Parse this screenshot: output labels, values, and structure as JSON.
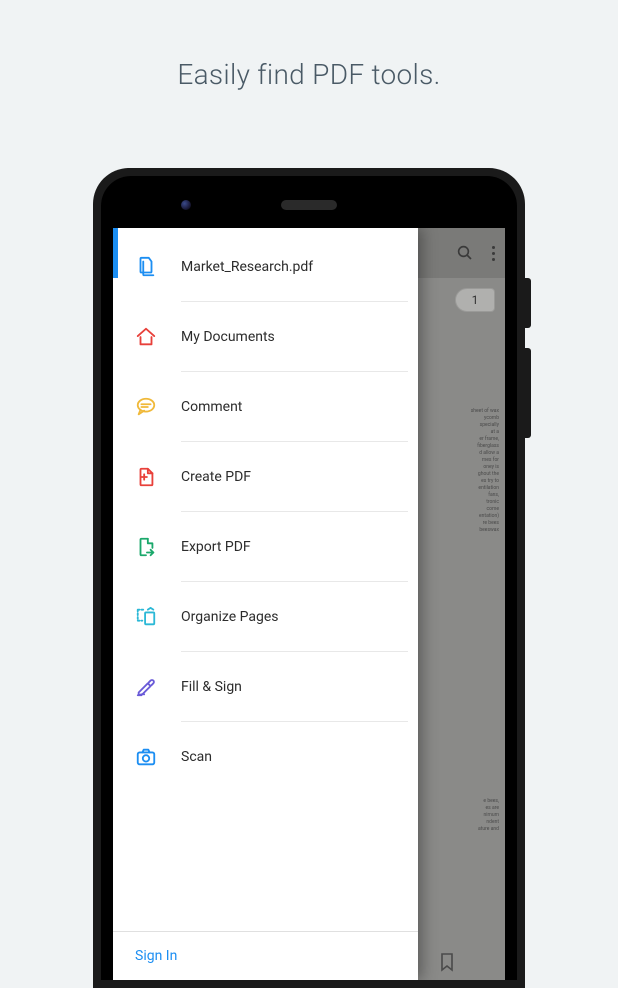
{
  "headline": "Easily find PDF tools.",
  "background": {
    "page_number": "1"
  },
  "drawer": {
    "items": [
      {
        "label": "Market_Research.pdf"
      },
      {
        "label": "My Documents"
      },
      {
        "label": "Comment"
      },
      {
        "label": "Create PDF"
      },
      {
        "label": "Export PDF"
      },
      {
        "label": "Organize Pages"
      },
      {
        "label": "Fill & Sign"
      },
      {
        "label": "Scan"
      }
    ],
    "footer": {
      "sign_in_label": "Sign In"
    }
  },
  "colors": {
    "accent": "#1c8ef2",
    "red": "#e8403a",
    "yellow": "#f0b93a",
    "green": "#1aa86b",
    "teal": "#2bb8d6",
    "purple": "#6a5bd8"
  }
}
